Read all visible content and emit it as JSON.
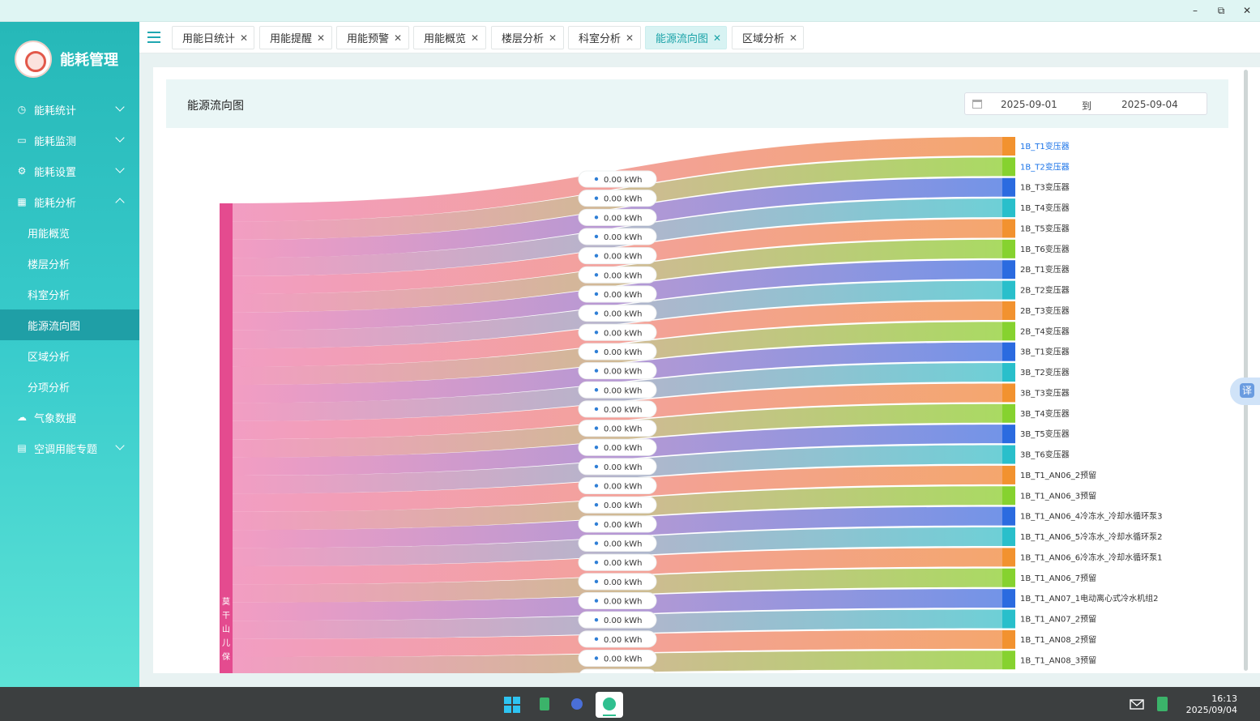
{
  "window": {
    "controls": [
      "–",
      "⧉",
      "✕"
    ]
  },
  "brand": {
    "title": "能耗管理"
  },
  "menu": [
    {
      "label": "能耗统计",
      "icon": "clock-icon",
      "expanded": false
    },
    {
      "label": "能耗监测",
      "icon": "monitor-icon",
      "expanded": false
    },
    {
      "label": "能耗设置",
      "icon": "gear-icon",
      "expanded": false
    },
    {
      "label": "能耗分析",
      "icon": "chart-icon",
      "expanded": true
    }
  ],
  "submenu": [
    "用能概览",
    "楼层分析",
    "科室分析",
    "能源流向图",
    "区域分析",
    "分项分析"
  ],
  "submenu_active": "能源流向图",
  "menu_bottom": [
    {
      "label": "气象数据",
      "icon": "cloud-icon"
    },
    {
      "label": "空调用能专题",
      "icon": "card-icon"
    }
  ],
  "tabs": [
    "用能日统计",
    "用能提醒",
    "用能预警",
    "用能概览",
    "楼层分析",
    "科室分析",
    "能源流向图",
    "区域分析"
  ],
  "tabs_active": "能源流向图",
  "panel": {
    "title": "能源流向图",
    "date_start": "2025-09-01",
    "date_separator": "到",
    "date_end": "2025-09-04"
  },
  "chart_data": {
    "type": "sankey",
    "source": "莫干山儿保",
    "unit": "kWh",
    "value_label": "0.00 kWh",
    "colors": [
      "#f3a266",
      "#a5d85a",
      "#6b8ee6",
      "#66cdd4"
    ],
    "node_colors": [
      "#f2922f",
      "#86d22f",
      "#2b6be0",
      "#29bfcb"
    ],
    "source_color": "#e44b8f",
    "targets": [
      {
        "name": "1B_T1变压器",
        "value": 0.0,
        "highlight": true
      },
      {
        "name": "1B_T2变压器",
        "value": 0.0,
        "highlight": true
      },
      {
        "name": "1B_T3变压器",
        "value": 0.0
      },
      {
        "name": "1B_T4变压器",
        "value": 0.0
      },
      {
        "name": "1B_T5变压器",
        "value": 0.0
      },
      {
        "name": "1B_T6变压器",
        "value": 0.0
      },
      {
        "name": "2B_T1变压器",
        "value": 0.0
      },
      {
        "name": "2B_T2变压器",
        "value": 0.0
      },
      {
        "name": "2B_T3变压器",
        "value": 0.0
      },
      {
        "name": "2B_T4变压器",
        "value": 0.0
      },
      {
        "name": "3B_T1变压器",
        "value": 0.0
      },
      {
        "name": "3B_T2变压器",
        "value": 0.0
      },
      {
        "name": "3B_T3变压器",
        "value": 0.0
      },
      {
        "name": "3B_T4变压器",
        "value": 0.0
      },
      {
        "name": "3B_T5变压器",
        "value": 0.0
      },
      {
        "name": "3B_T6变压器",
        "value": 0.0
      },
      {
        "name": "1B_T1_AN06_2预留",
        "value": 0.0
      },
      {
        "name": "1B_T1_AN06_3预留",
        "value": 0.0
      },
      {
        "name": "1B_T1_AN06_4冷冻水_冷却水循环泵3",
        "value": 0.0
      },
      {
        "name": "1B_T1_AN06_5冷冻水_冷却水循环泵2",
        "value": 0.0
      },
      {
        "name": "1B_T1_AN06_6冷冻水_冷却水循环泵1",
        "value": 0.0
      },
      {
        "name": "1B_T1_AN06_7预留",
        "value": 0.0
      },
      {
        "name": "1B_T1_AN07_1电动离心式冷水机组2",
        "value": 0.0
      },
      {
        "name": "1B_T1_AN07_2预留",
        "value": 0.0
      },
      {
        "name": "1B_T1_AN08_2预留",
        "value": 0.0
      },
      {
        "name": "1B_T1_AN08_3预留",
        "value": 0.0
      }
    ]
  },
  "taskbar": {
    "time": "16:13",
    "date": "2025/09/04"
  }
}
